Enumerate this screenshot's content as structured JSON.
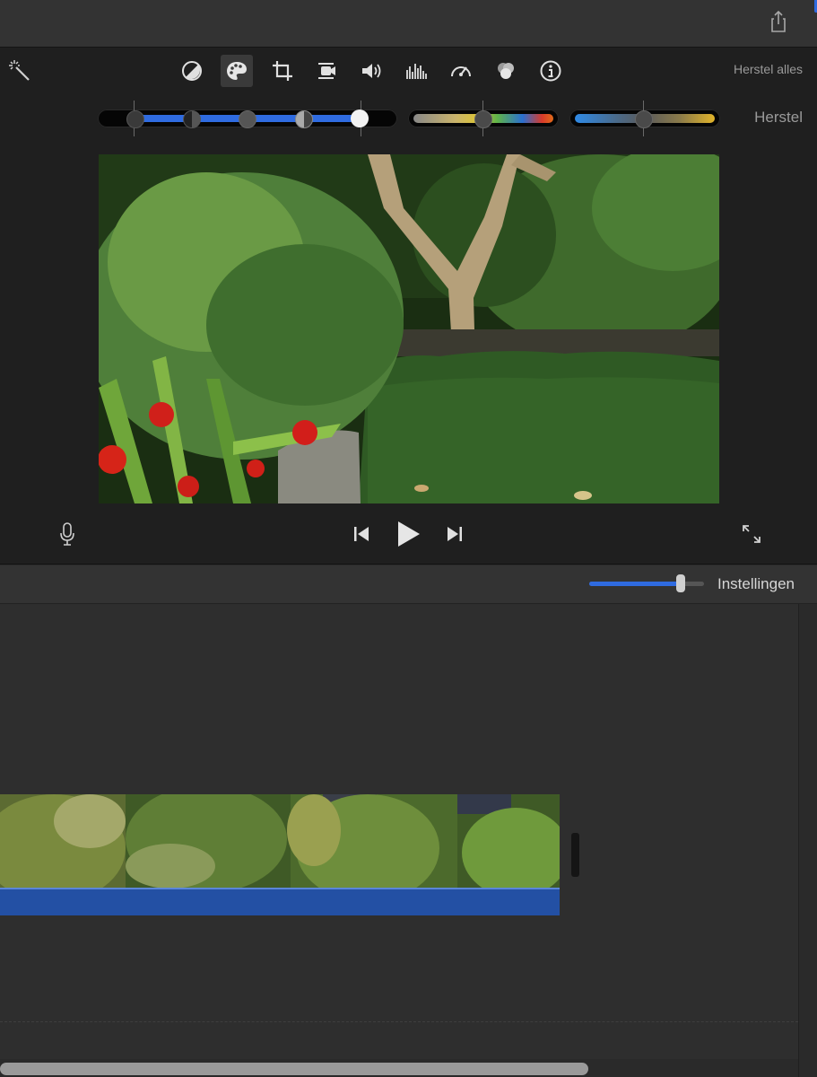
{
  "toolbar": {
    "reset_all_label": "Herstel alles",
    "tools": [
      {
        "icon": "color-balance-icon",
        "active": false
      },
      {
        "icon": "color-correction-palette-icon",
        "active": true
      },
      {
        "icon": "crop-icon",
        "active": false
      },
      {
        "icon": "stabilization-camera-icon",
        "active": false
      },
      {
        "icon": "volume-icon",
        "active": false
      },
      {
        "icon": "equalizer-icon",
        "active": false
      },
      {
        "icon": "speed-gauge-icon",
        "active": false
      },
      {
        "icon": "clip-filter-icon",
        "active": false
      },
      {
        "icon": "info-icon",
        "active": false
      }
    ]
  },
  "color_correction": {
    "reset_label": "Herstel",
    "colors": {
      "accent": "#2f6be0",
      "track": "#050505"
    }
  },
  "playback": {
    "mic_icon": "microphone-icon",
    "prev_icon": "skip-back-icon",
    "play_icon": "play-icon",
    "next_icon": "skip-forward-icon",
    "fullscreen_icon": "fullscreen-icon"
  },
  "timeline_bar": {
    "settings_label": "Instellingen",
    "zoom_level": 0.8
  }
}
